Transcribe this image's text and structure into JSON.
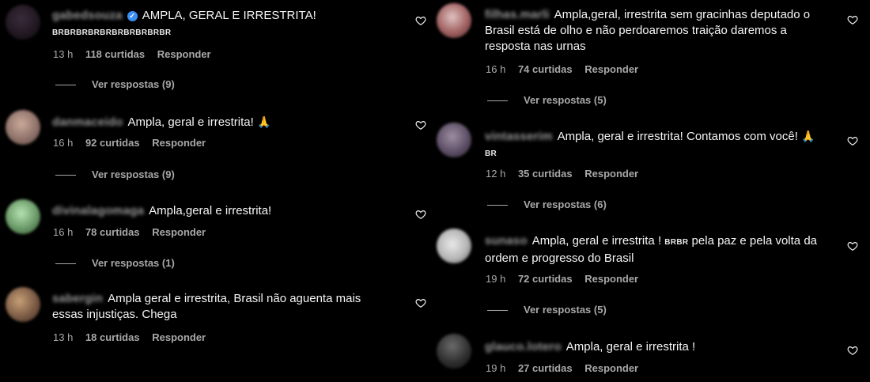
{
  "left_comments": [
    {
      "username": "gabedsouza",
      "verified": true,
      "text": "AMPLA, GERAL E IRRESTRITA!",
      "flags": "BRBRBRBRBRBRBRBRBRBR",
      "time": "13 h",
      "likes": "118 curtidas",
      "reply_label": "Responder",
      "view_replies": "Ver respostas (9)"
    },
    {
      "username": "danmaceido",
      "text": "Ampla, geral e irrestrita!",
      "emoji": "🙏",
      "time": "16 h",
      "likes": "92 curtidas",
      "reply_label": "Responder",
      "view_replies": "Ver respostas (9)"
    },
    {
      "username": "divinalagomaga",
      "text": "Ampla,geral e irrestrita!",
      "time": "16 h",
      "likes": "78 curtidas",
      "reply_label": "Responder",
      "view_replies": "Ver respostas (1)"
    },
    {
      "username": "sabergin",
      "text": "Ampla geral e irrestrita, Brasil não aguenta mais essas injustiças. Chega",
      "time": "13 h",
      "likes": "18 curtidas",
      "reply_label": "Responder"
    }
  ],
  "right_comments": [
    {
      "username": "filhas.marli",
      "text": "Ampla,geral, irrestrita sem gracinhas deputado o Brasil está de olho e não perdoaremos traição daremos a resposta nas urnas",
      "time": "16 h",
      "likes": "74 curtidas",
      "reply_label": "Responder",
      "view_replies": "Ver respostas (5)"
    },
    {
      "username": "vintasserim",
      "text": "Ampla, geral e irrestrita! Contamos com você!",
      "emoji": "🙏",
      "flags": "BR",
      "time": "12 h",
      "likes": "35 curtidas",
      "reply_label": "Responder",
      "view_replies": "Ver respostas (6)"
    },
    {
      "username": "sunaso",
      "text_a": "Ampla, geral e irrestrita !",
      "flags": "BRBR",
      "text_b": "pela paz e pela volta da ordem e progresso do Brasil",
      "time": "19 h",
      "likes": "72 curtidas",
      "reply_label": "Responder",
      "view_replies": "Ver respostas (5)"
    },
    {
      "username": "glauco.lotero",
      "text": "Ampla, geral e irrestrita !",
      "time": "19 h",
      "likes": "27 curtidas",
      "reply_label": "Responder"
    }
  ],
  "icons": {
    "like": "heart-outline-icon",
    "verified": "verified-badge-icon"
  },
  "colors": {
    "background": "#000000",
    "text": "#f5f5f5",
    "muted": "#a8a8a8",
    "verified": "#3b8ef3"
  }
}
